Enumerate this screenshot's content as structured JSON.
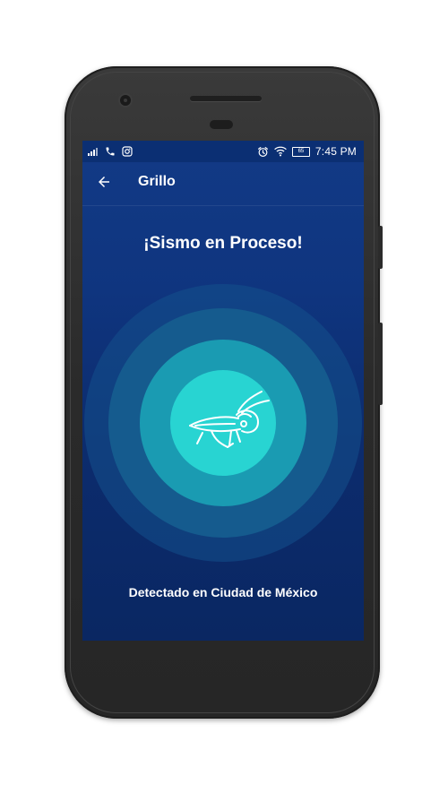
{
  "status_bar": {
    "time": "7:45 PM",
    "battery": "65",
    "left_icons": [
      "signal-icon",
      "phone-icon",
      "instagram-icon"
    ],
    "right_icons": [
      "alarm-icon",
      "wifi-icon",
      "battery-icon"
    ]
  },
  "app_bar": {
    "title": "Grillo",
    "back_icon": "arrow-left-icon"
  },
  "main": {
    "headline": "¡Sismo en Proceso!",
    "center_icon": "cricket-icon",
    "location": "Detectado en Ciudad de México"
  },
  "colors": {
    "screen_bg": "#0f357f",
    "status_bar": "#0b2f73",
    "ring_outer": "#155b8e",
    "ring_mid": "#1a9bb2",
    "ring_inner": "#28d4d2",
    "text": "#ffffff",
    "phone_body": "#2e2e2e"
  }
}
